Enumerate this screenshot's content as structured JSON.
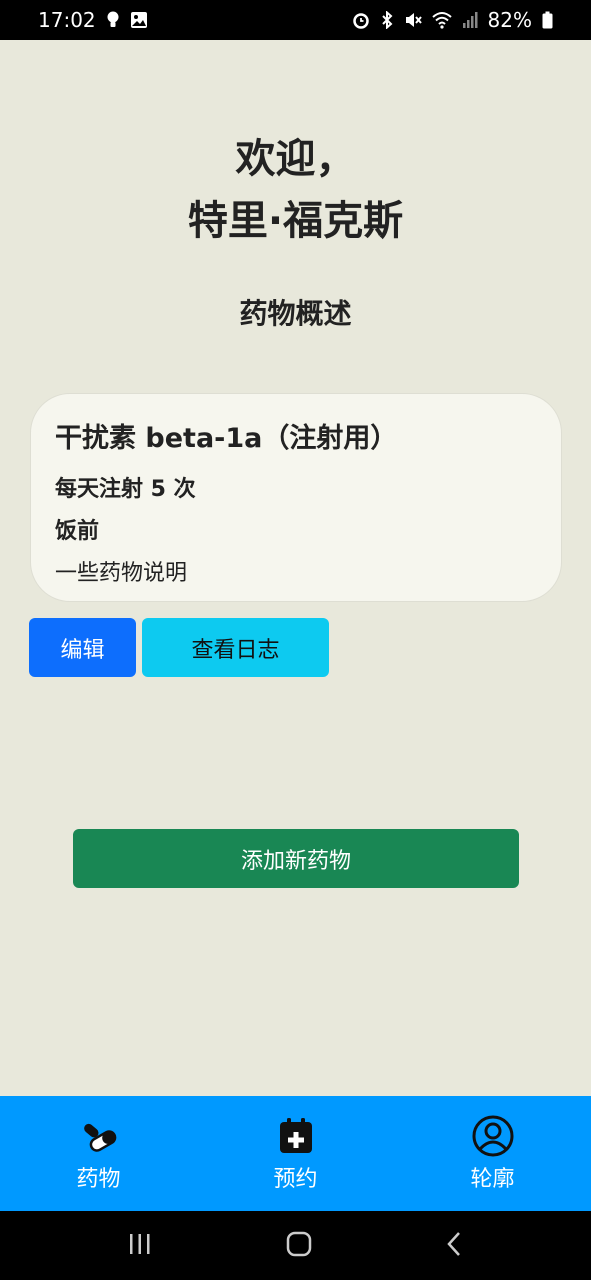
{
  "status_bar": {
    "time": "17:02",
    "battery": "82%",
    "icons_left": [
      "bulb-icon",
      "image-icon"
    ],
    "icons_right": [
      "alarm-icon",
      "bluetooth-icon",
      "mute-icon",
      "wifi-icon",
      "signal-icon",
      "battery-icon"
    ]
  },
  "header": {
    "welcome_line1": "欢迎，",
    "welcome_line2": "特里·福克斯",
    "section_title": "药物概述"
  },
  "medication": {
    "name": "干扰素 beta-1a（注射用）",
    "dose": "每天注射 5 次",
    "timing": "饭前",
    "description": "一些药物说明"
  },
  "actions": {
    "edit_label": "编辑",
    "view_log_label": "查看日志",
    "add_label": "添加新药物"
  },
  "bottom_nav": {
    "items": [
      {
        "label": "药物",
        "icon": "pills-icon"
      },
      {
        "label": "预约",
        "icon": "calendar-plus-icon"
      },
      {
        "label": "轮廓",
        "icon": "user-circle-icon"
      }
    ]
  },
  "colors": {
    "background": "#e8e8db",
    "primary": "#0d6efd",
    "info": "#0dcaf0",
    "success": "#198754",
    "nav": "#0099ff"
  }
}
